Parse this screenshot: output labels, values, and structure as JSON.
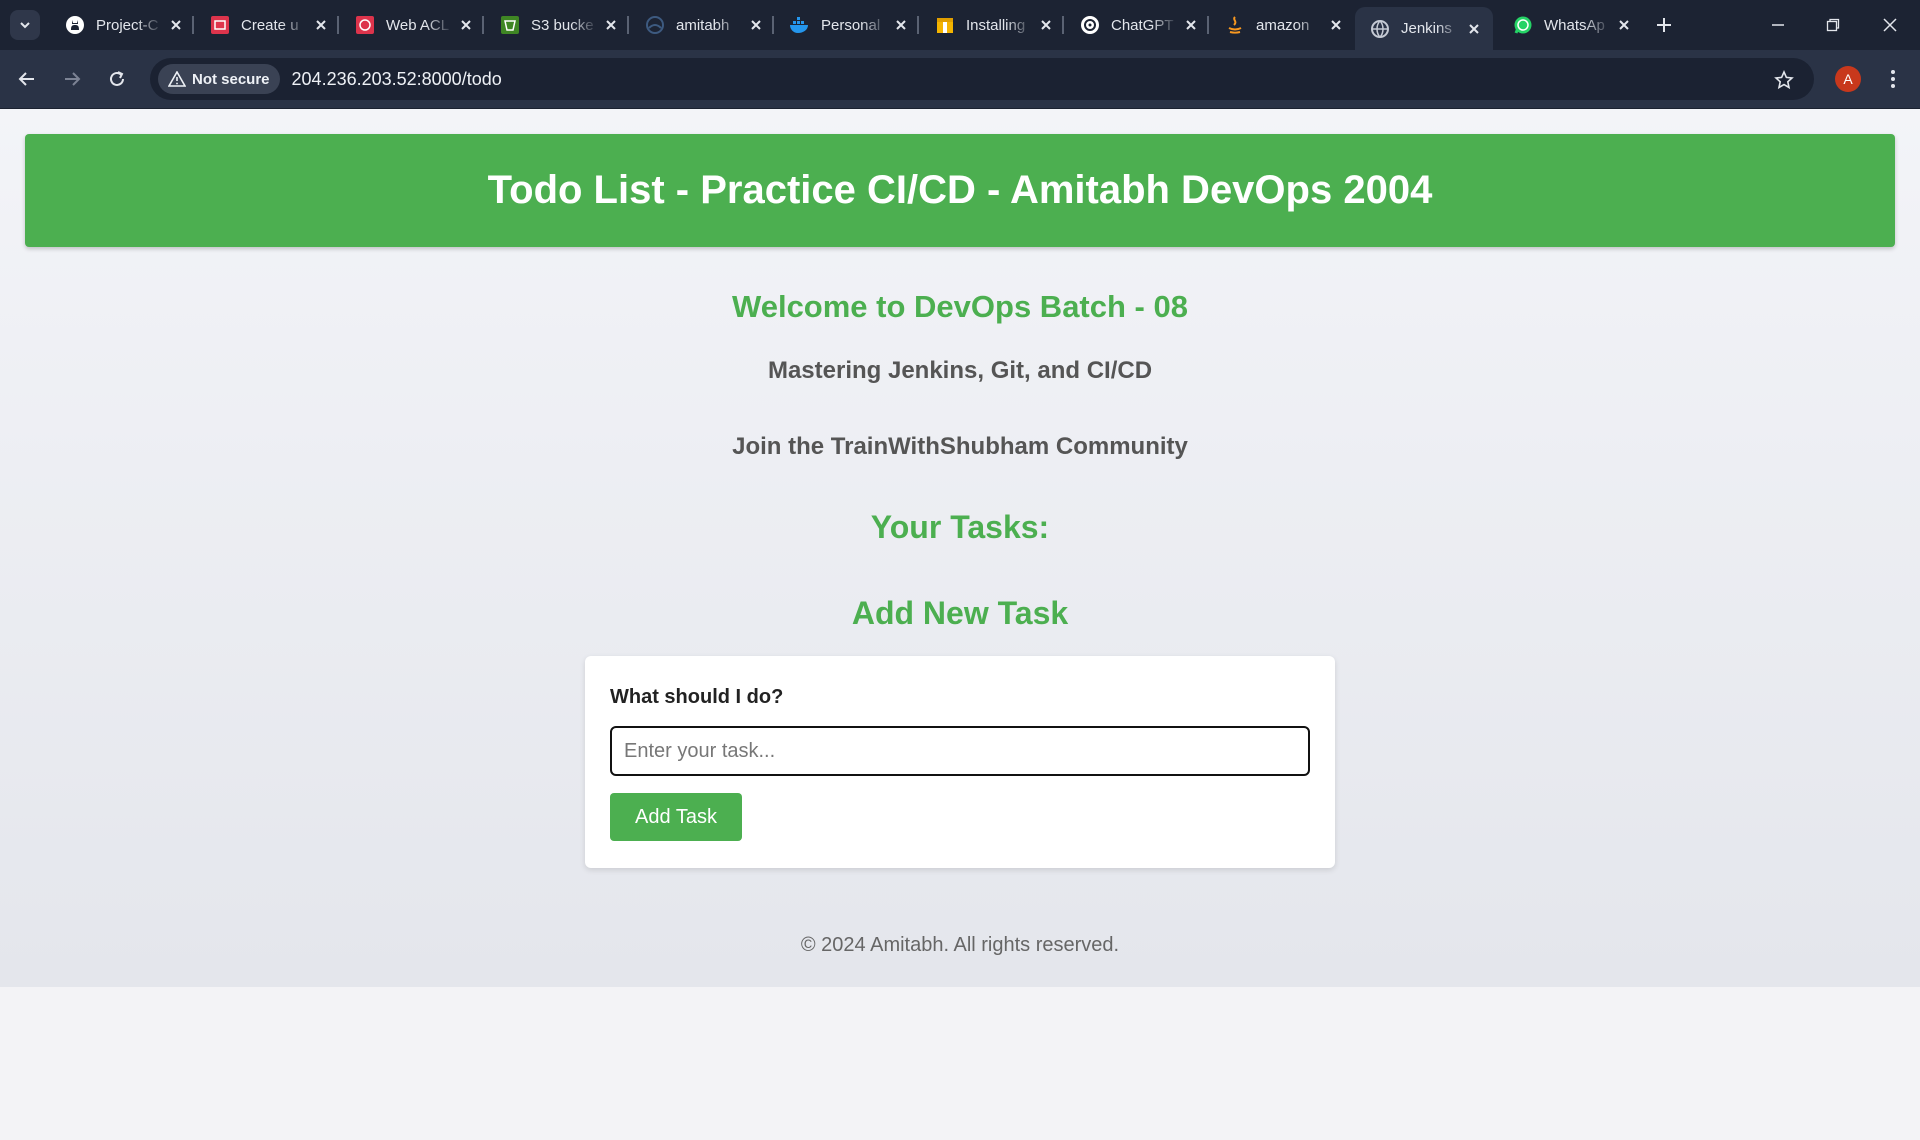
{
  "browser": {
    "tabs": [
      {
        "title": "Project-C",
        "icon": "github-icon"
      },
      {
        "title": "Create u",
        "icon": "aws-console-icon"
      },
      {
        "title": "Web ACL",
        "icon": "waf-icon"
      },
      {
        "title": "S3 bucke",
        "icon": "s3-icon"
      },
      {
        "title": "amitabh",
        "icon": "globe-icon"
      },
      {
        "title": "Personal",
        "icon": "docker-icon"
      },
      {
        "title": "Installing",
        "icon": "package-icon"
      },
      {
        "title": "ChatGPT",
        "icon": "chatgpt-icon"
      },
      {
        "title": "amazon",
        "icon": "java-icon"
      },
      {
        "title": "Jenkins",
        "icon": "globe-icon"
      },
      {
        "title": "WhatsAp",
        "icon": "whatsapp-icon"
      }
    ],
    "active_tab_index": 9,
    "security_chip": "Not secure",
    "url": "204.236.203.52:8000/todo",
    "profile_initial": "A",
    "colors": {
      "tabbar": "#1c2333",
      "toolbar": "#2a3346",
      "avatar": "#c8381c"
    }
  },
  "page": {
    "header_title": "Todo List - Practice CI/CD - Amitabh DevOps 2004",
    "welcome": "Welcome to DevOps Batch - 08",
    "subtitle": "Mastering Jenkins, Git, and CI/CD",
    "community": "Join the TrainWithShubham Community",
    "tasks_heading": "Your Tasks:",
    "add_heading": "Add New Task",
    "form": {
      "label": "What should I do?",
      "input_placeholder": "Enter your task...",
      "input_value": "",
      "submit_label": "Add Task"
    },
    "footer": "© 2024 Amitabh. All rights reserved.",
    "colors": {
      "accent": "#4caf50",
      "muted_text": "#555555"
    }
  }
}
